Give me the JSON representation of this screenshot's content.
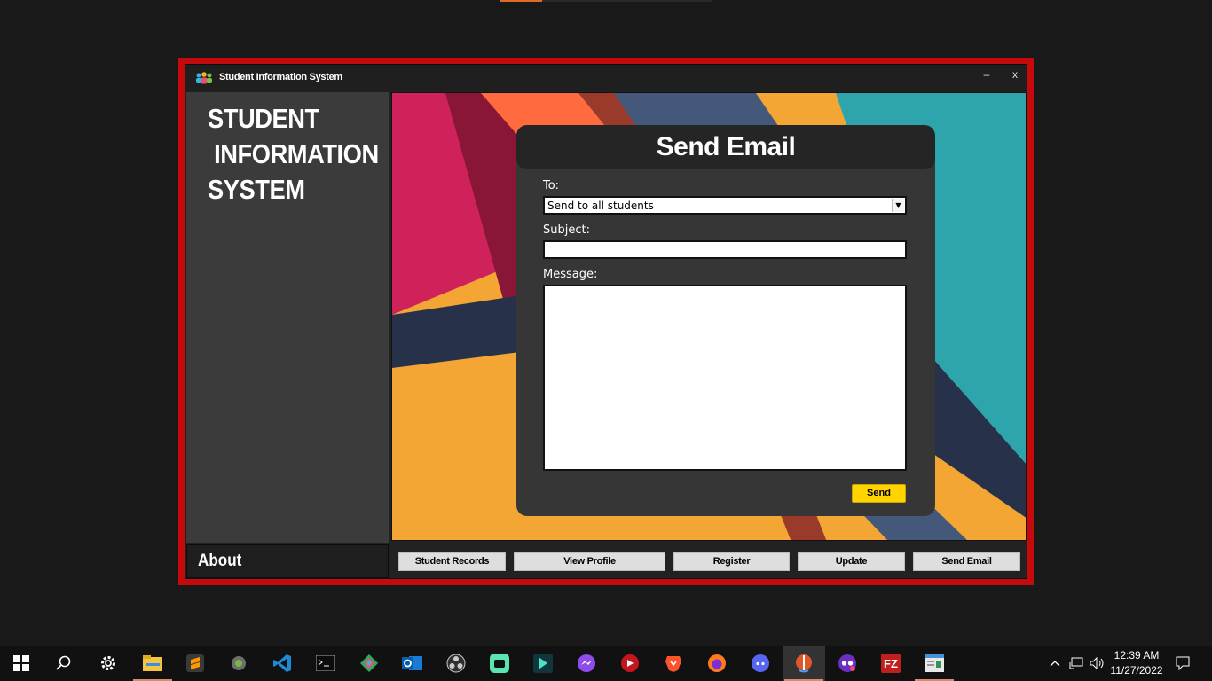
{
  "app": {
    "title": "Student Information System",
    "minimize_label": "–",
    "close_label": "x"
  },
  "sidebar": {
    "brand_lines": [
      "STUDENT",
      " INFORMATION",
      "SYSTEM"
    ],
    "about_label": "About"
  },
  "email_form": {
    "title": "Send Email",
    "to_label": "To:",
    "to_selected": "Send to all students",
    "subject_label": "Subject:",
    "subject_value": "",
    "message_label": "Message:",
    "message_value": "",
    "send_label": "Send"
  },
  "nav": {
    "student_records": "Student Records",
    "view_profile": "View Profile",
    "register": "Register",
    "update": "Update",
    "send_email": "Send Email"
  },
  "taskbar": {
    "icons": [
      "windows-start",
      "search",
      "settings",
      "file-explorer",
      "sublime-text",
      "git-tool",
      "vscode",
      "terminal",
      "git-kraken",
      "outlook",
      "obs-studio",
      "app-green",
      "app-teal",
      "messenger",
      "youtube-app",
      "brave",
      "firefox",
      "discord",
      "java-app",
      "incognito-app",
      "filezilla",
      "notepad-app"
    ],
    "time": "12:39 AM",
    "date": "11/27/2022"
  },
  "colors": {
    "window_border": "#c40a0a",
    "send_button": "#ffd400",
    "background_orange": "#f4a634",
    "background_teal": "#2ea5ac",
    "background_pink": "#d0225a"
  }
}
